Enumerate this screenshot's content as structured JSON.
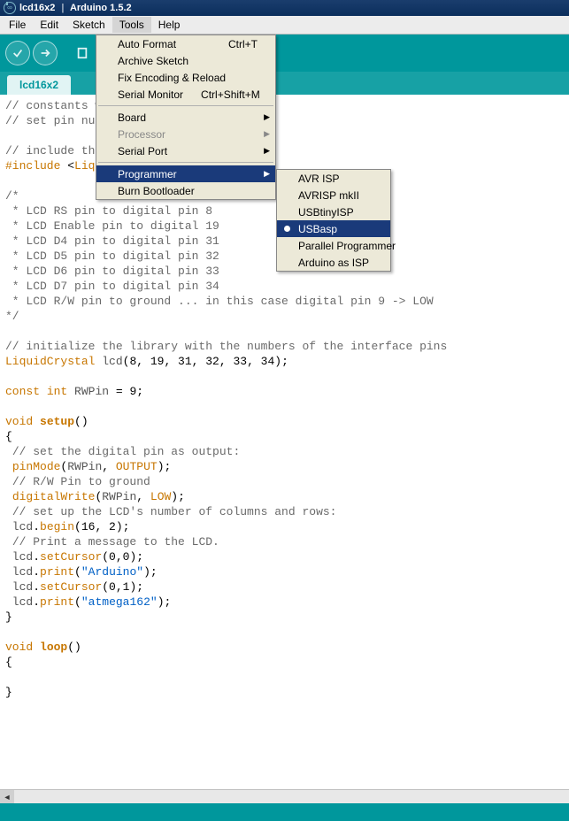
{
  "window": {
    "title_sketch": "lcd16x2",
    "title_sep": "|",
    "title_app": "Arduino 1.5.2"
  },
  "menubar": [
    "File",
    "Edit",
    "Sketch",
    "Tools",
    "Help"
  ],
  "toolbar_icons": [
    "verify",
    "upload",
    "new",
    "open",
    "save"
  ],
  "tab": {
    "name": "lcd16x2"
  },
  "tools_menu": {
    "items_top": [
      {
        "label": "Auto Format",
        "shortcut": "Ctrl+T"
      },
      {
        "label": "Archive Sketch",
        "shortcut": ""
      },
      {
        "label": "Fix Encoding & Reload",
        "shortcut": ""
      },
      {
        "label": "Serial Monitor",
        "shortcut": "Ctrl+Shift+M"
      }
    ],
    "items_mid": [
      {
        "label": "Board",
        "sub": true,
        "disabled": false
      },
      {
        "label": "Processor",
        "sub": true,
        "disabled": true
      },
      {
        "label": "Serial Port",
        "sub": true,
        "disabled": false
      }
    ],
    "items_bot": [
      {
        "label": "Programmer",
        "sub": true,
        "selected": true
      },
      {
        "label": "Burn Bootloader",
        "sub": false
      }
    ]
  },
  "programmer_menu": {
    "items": [
      {
        "label": "AVR ISP"
      },
      {
        "label": "AVRISP mkII"
      },
      {
        "label": "USBtinyISP"
      },
      {
        "label": "USBasp",
        "selected": true,
        "checked": true
      },
      {
        "label": "Parallel Programmer"
      },
      {
        "label": "Arduino as ISP"
      }
    ]
  },
  "code_lines": [
    "// constants w",
    "// set pin num",
    "",
    "// include the",
    "#include <Liqu",
    "",
    "/*",
    " * LCD RS pin to digital pin 8",
    " * LCD Enable pin to digital 19",
    " * LCD D4 pin to digital pin 31",
    " * LCD D5 pin to digital pin 32",
    " * LCD D6 pin to digital pin 33",
    " * LCD D7 pin to digital pin 34",
    " * LCD R/W pin to ground ... in this case digital pin 9 -> LOW",
    "*/",
    "",
    "// initialize the library with the numbers of the interface pins",
    "LiquidCrystal lcd(8, 19, 31, 32, 33, 34);",
    "",
    "const int RWPin = 9;",
    "",
    "void setup()",
    "{",
    " // set the digital pin as output:",
    " pinMode(RWPin, OUTPUT);",
    " // R/W Pin to ground",
    " digitalWrite(RWPin, LOW);",
    " // set up the LCD's number of columns and rows:",
    " lcd.begin(16, 2);",
    " // Print a message to the LCD.",
    " lcd.setCursor(0,0);",
    " lcd.print(\"Arduino\");",
    " lcd.setCursor(0,1);",
    " lcd.print(\"atmega162\");",
    "}",
    "",
    "void loop()",
    "{",
    " ",
    "}"
  ]
}
